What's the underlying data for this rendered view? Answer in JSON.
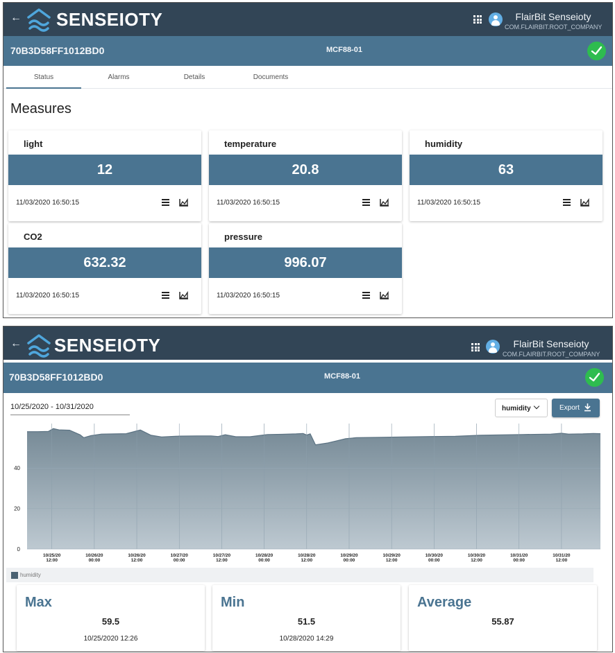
{
  "app": {
    "back_icon": "arrow-left-icon",
    "brand": "SENSEIOTY",
    "user_name": "FlairBit Senseioty",
    "company": "COM.FLAIRBIT.ROOT_COMPANY"
  },
  "device": {
    "id": "70B3D58FF1012BD0",
    "model": "MCF88-01",
    "status_icon": "check-icon",
    "status_color": "#2ebc4f"
  },
  "tabs": [
    {
      "label": "Status",
      "active": true
    },
    {
      "label": "Alarms"
    },
    {
      "label": "Details"
    },
    {
      "label": "Documents"
    }
  ],
  "measures": {
    "title": "Measures",
    "cards": [
      {
        "name": "light",
        "value": "12",
        "date": "11/03/2020 16:50:15"
      },
      {
        "name": "temperature",
        "value": "20.8",
        "date": "11/03/2020 16:50:15"
      },
      {
        "name": "humidity",
        "value": "63",
        "date": "11/03/2020 16:50:15"
      },
      {
        "name": "CO2",
        "value": "632.32",
        "date": "11/03/2020 16:50:15"
      },
      {
        "name": "pressure",
        "value": "996.07",
        "date": "11/03/2020 16:50:15"
      }
    ]
  },
  "history": {
    "date_range": "10/25/2020 - 10/31/2020",
    "selected_measure": "humidity",
    "export_label": "Export"
  },
  "chart_data": {
    "type": "area",
    "series": [
      {
        "name": "humidity",
        "color": "#6d8391",
        "points": [
          [
            "10/25/2020 05:00",
            58.0
          ],
          [
            "10/25/2020 08:00",
            58.0
          ],
          [
            "10/25/2020 11:00",
            58.1
          ],
          [
            "10/25/2020 12:26",
            59.5
          ],
          [
            "10/25/2020 14:00",
            58.9
          ],
          [
            "10/25/2020 17:00",
            58.7
          ],
          [
            "10/25/2020 20:00",
            56.4
          ],
          [
            "10/25/2020 21:00",
            55.0
          ],
          [
            "10/25/2020 23:00",
            56.0
          ],
          [
            "10/26/2020 02:00",
            56.8
          ],
          [
            "10/26/2020 06:00",
            56.9
          ],
          [
            "10/26/2020 09:00",
            57.0
          ],
          [
            "10/26/2020 13:00",
            58.8
          ],
          [
            "10/26/2020 16:00",
            56.2
          ],
          [
            "10/26/2020 19:00",
            55.4
          ],
          [
            "10/27/2020 00:00",
            55.8
          ],
          [
            "10/27/2020 05:00",
            55.9
          ],
          [
            "10/27/2020 09:00",
            55.9
          ],
          [
            "10/27/2020 11:00",
            55.6
          ],
          [
            "10/27/2020 13:00",
            56.5
          ],
          [
            "10/27/2020 16:00",
            55.5
          ],
          [
            "10/27/2020 20:00",
            55.5
          ],
          [
            "10/28/2020 01:00",
            56.6
          ],
          [
            "10/28/2020 05:00",
            56.7
          ],
          [
            "10/28/2020 09:00",
            56.9
          ],
          [
            "10/28/2020 11:00",
            57.1
          ],
          [
            "10/28/2020 12:00",
            56.3
          ],
          [
            "10/28/2020 13:00",
            56.9
          ],
          [
            "10/28/2020 14:29",
            51.5
          ],
          [
            "10/28/2020 18:00",
            52.4
          ],
          [
            "10/28/2020 23:00",
            54.5
          ],
          [
            "10/29/2020 02:00",
            55.0
          ],
          [
            "10/29/2020 09:00",
            55.2
          ],
          [
            "10/29/2020 15:00",
            55.4
          ],
          [
            "10/29/2020 23:00",
            55.6
          ],
          [
            "10/30/2020 06:00",
            55.7
          ],
          [
            "10/30/2020 13:00",
            56.2
          ],
          [
            "10/30/2020 19:00",
            56.4
          ],
          [
            "10/31/2020 01:00",
            56.6
          ],
          [
            "10/31/2020 09:00",
            56.8
          ],
          [
            "10/31/2020 12:00",
            57.2
          ],
          [
            "10/31/2020 14:00",
            56.8
          ],
          [
            "10/31/2020 18:00",
            56.9
          ],
          [
            "10/31/2020 21:00",
            57.1
          ],
          [
            "10/31/2020 23:00",
            57.0
          ]
        ]
      }
    ],
    "x_ticks": [
      [
        "10/25/20",
        "12:00"
      ],
      [
        "10/26/20",
        "00:00"
      ],
      [
        "10/26/20",
        "12:00"
      ],
      [
        "10/27/20",
        "00:00"
      ],
      [
        "10/27/20",
        "12:00"
      ],
      [
        "10/28/20",
        "00:00"
      ],
      [
        "10/28/20",
        "12:00"
      ],
      [
        "10/29/20",
        "00:00"
      ],
      [
        "10/29/20",
        "12:00"
      ],
      [
        "10/30/20",
        "00:00"
      ],
      [
        "10/30/20",
        "12:00"
      ],
      [
        "10/31/20",
        "00:00"
      ],
      [
        "10/31/20",
        "12:00"
      ]
    ],
    "xlim": [
      "10/25/2020 05:00",
      "10/31/2020 23:00"
    ],
    "y_ticks": [
      0,
      20,
      40
    ],
    "ylim": [
      0,
      62
    ],
    "grid": true,
    "legend": "bottom-left"
  },
  "stats": [
    {
      "label": "Max",
      "value": "59.5",
      "date": "10/25/2020 12:26"
    },
    {
      "label": "Min",
      "value": "51.5",
      "date": "10/28/2020 14:29"
    },
    {
      "label": "Average",
      "value": "55.87",
      "date": ""
    }
  ]
}
